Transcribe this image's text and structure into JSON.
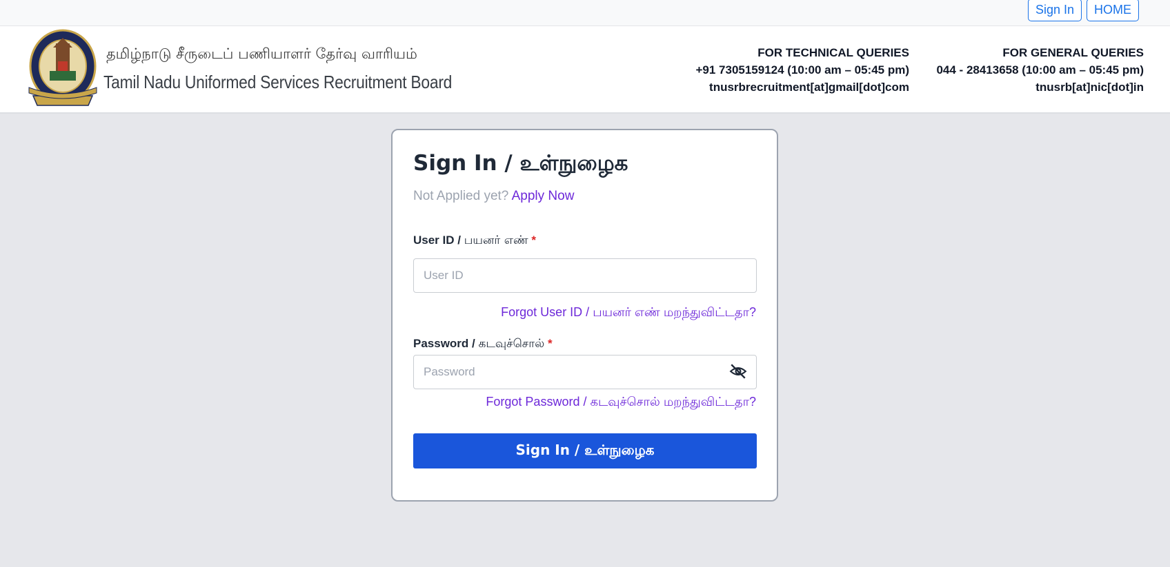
{
  "topbar": {
    "signin_label": "Sign In",
    "home_label": "HOME",
    "accent": "#1a73e8"
  },
  "header": {
    "org_name_tamil": "தமிழ்நாடு சீருடைப் பணியாளர் தேர்வு வாரியம்",
    "org_name_english": "Tamil Nadu Uniformed Services Recruitment Board",
    "logo_icon": "tnusrb-emblem-icon",
    "technical": {
      "heading": "FOR TECHNICAL QUERIES",
      "phone": "+91 7305159124  (10:00 am – 05:45 pm)",
      "email": "tnusrbrecruitment[at]gmail[dot]com"
    },
    "general": {
      "heading": "FOR GENERAL QUERIES",
      "phone": "044 - 28413658  (10:00 am – 05:45 pm)",
      "email": "tnusrb[at]nic[dot]in"
    }
  },
  "login": {
    "title": "Sign In / உள்நுழைக",
    "not_applied_text": "Not Applied yet?",
    "apply_now_label": "Apply Now",
    "userid_label": "User ID / ",
    "userid_label_tamil": "பயனர் எண்",
    "required_mark": "*",
    "userid_placeholder": "User ID",
    "userid_value": "",
    "forgot_userid_label": "Forgot User ID / பயனர் எண் மறந்துவிட்டதா?",
    "password_label": "Password / ",
    "password_label_tamil": "கடவுச்சொல்",
    "password_placeholder": "Password",
    "password_value": "",
    "password_toggle_icon": "eye-slash-icon",
    "forgot_password_label": "Forgot Password / கடவுச்சொல் மறந்துவிட்டதா?",
    "submit_label": "Sign In / உள்நுழைக",
    "submit_color": "#1a56db",
    "link_color": "#6d28d9"
  }
}
